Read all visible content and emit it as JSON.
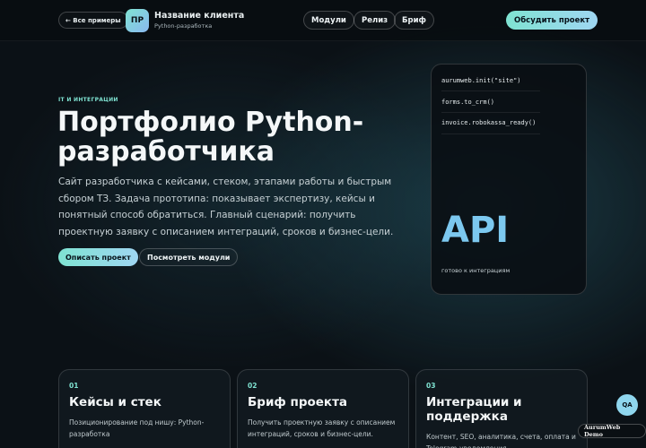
{
  "header": {
    "back_label": "← Все примеры",
    "logo_initials": "ПР",
    "client_name": "Название клиента",
    "client_subtitle": "Python-разработка",
    "nav": [
      "Модули",
      "Релиз",
      "Бриф"
    ],
    "cta": "Обсудить проект"
  },
  "hero": {
    "eyebrow": "IT И ИНТЕГРАЦИИ",
    "title": "Портфолио Python-разработчика",
    "description": "Сайт разработчика с кейсами, стеком, этапами работы и быстрым сбором ТЗ. Задача прототипа: показывает экспертизу, кейсы и понятный способ обратиться. Главный сценарий: получить проектную заявку с описанием интеграций, сроков и бизнес-цели.",
    "primary_button": "Описать проект",
    "secondary_button": "Посмотреть модули"
  },
  "code_card": {
    "lines": [
      "aurumweb.init(\"site\")",
      "forms.to_crm()",
      "invoice.robokassa_ready()"
    ],
    "big_word": "API",
    "caption": "готово к интеграциям"
  },
  "features": [
    {
      "num": "01",
      "title": "Кейсы и стек",
      "desc": "Позиционирование под нишу: Python-разработка"
    },
    {
      "num": "02",
      "title": "Бриф проекта",
      "desc": "Получить проектную заявку с описанием интеграций, сроков и бизнес-цели."
    },
    {
      "num": "03",
      "title": "Интеграции и поддержка",
      "desc": "Контент, SEO, аналитика, счета, оплата и Telegram-уведомления."
    }
  ],
  "floating": {
    "qa_label": "QA",
    "demo_badge": "AurumWeb Demo"
  },
  "colors": {
    "accent": "#7fe3d2",
    "api_blue": "#7cc8ef",
    "background": "#0b1116"
  }
}
